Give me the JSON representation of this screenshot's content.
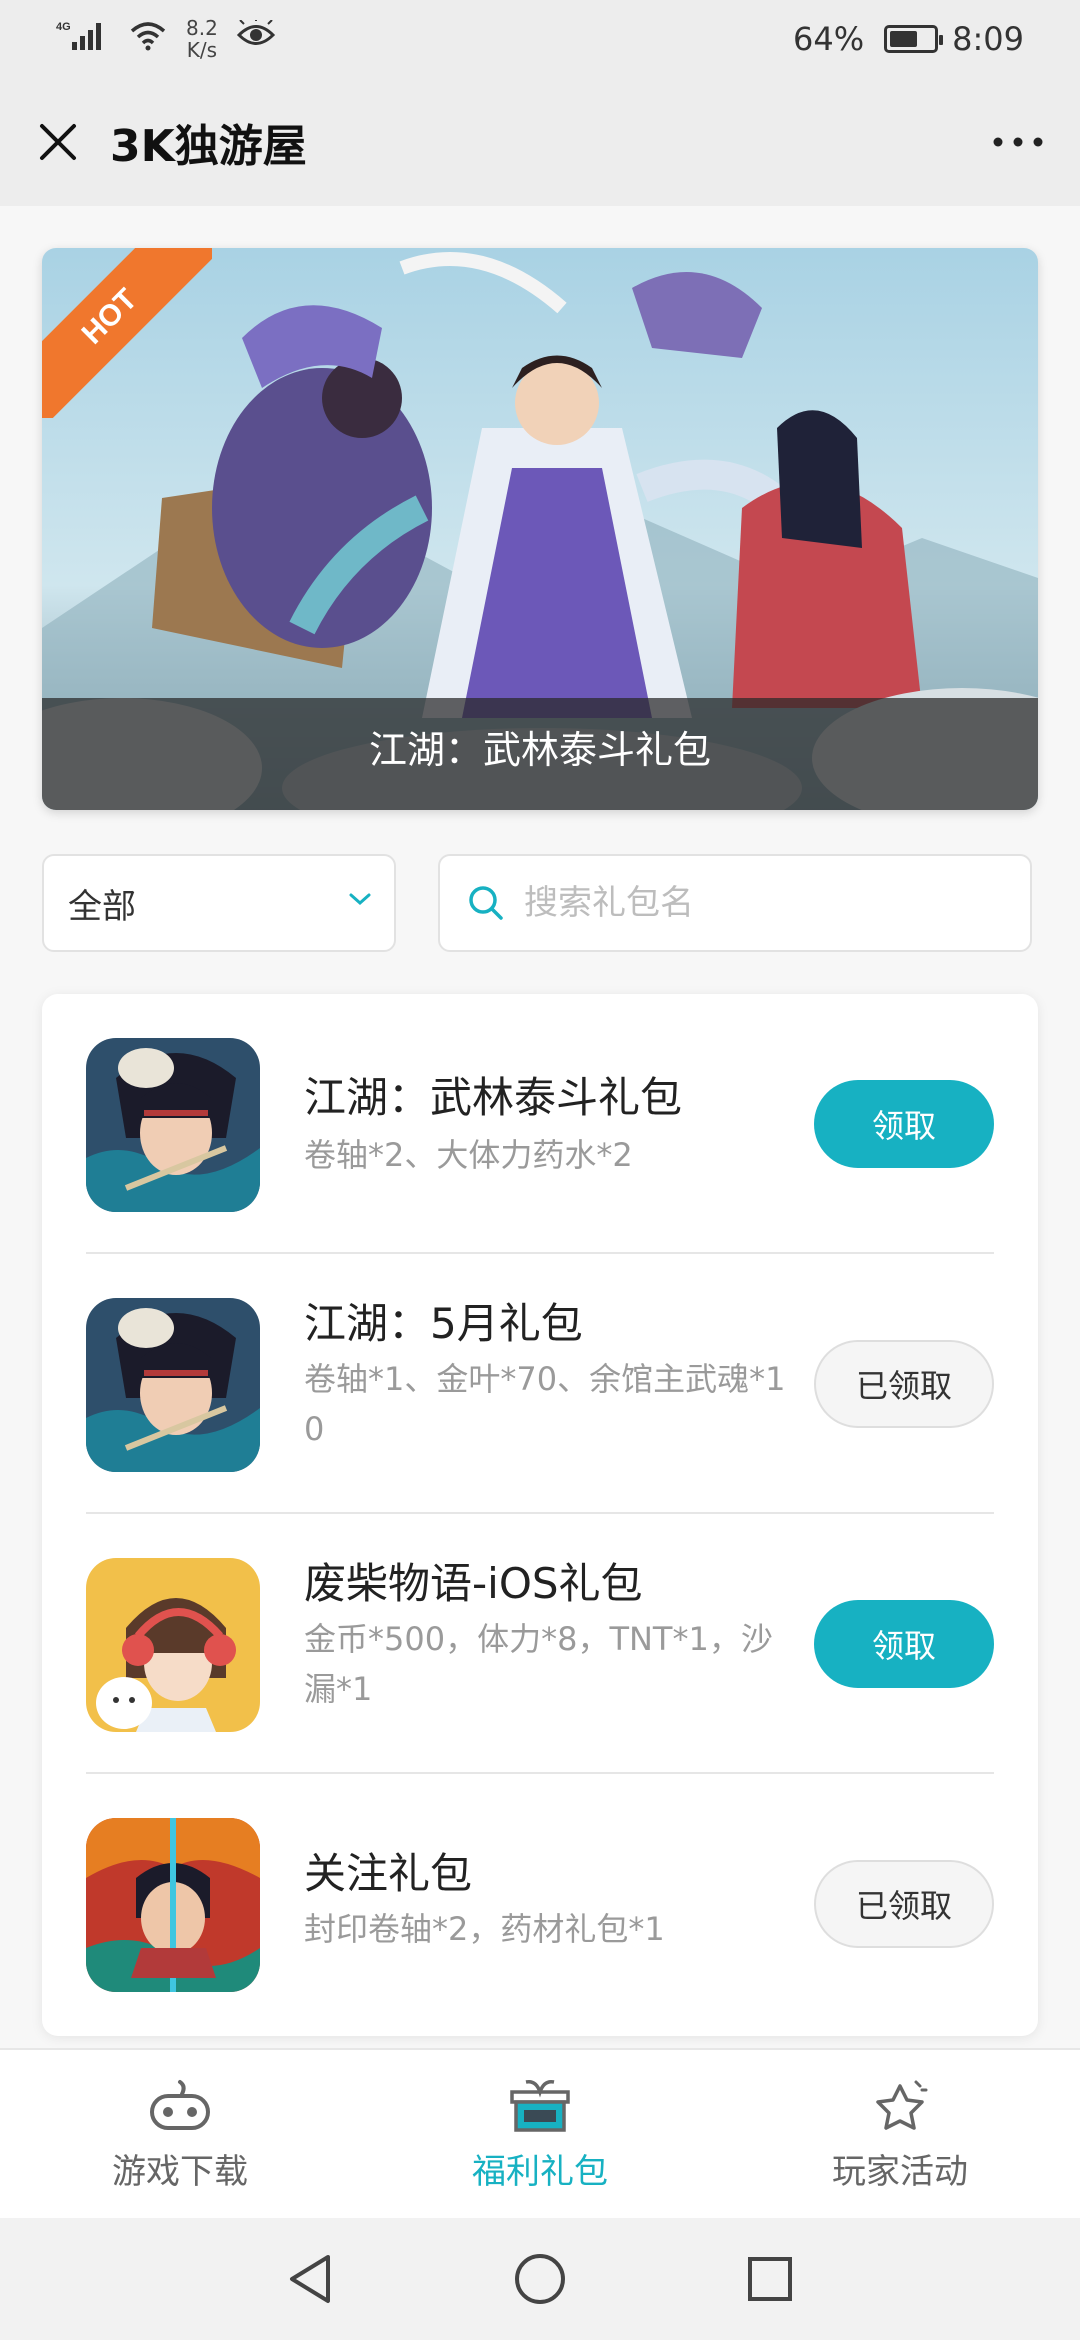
{
  "status_bar": {
    "network": "4G",
    "speed_value": "8.2",
    "speed_unit": "K/s",
    "battery": "64%",
    "battery_level": 0.64,
    "time": "8:09"
  },
  "header": {
    "title": "3K独游屋"
  },
  "banner": {
    "badge": "HOT",
    "caption": "江湖：武林泰斗礼包"
  },
  "filter": {
    "selected": "全部"
  },
  "search": {
    "placeholder": "搜索礼包名"
  },
  "gifts": [
    {
      "name": "江湖：武林泰斗礼包",
      "desc": "卷轴*2、大体力药水*2",
      "button": "领取",
      "claimed": false
    },
    {
      "name": "江湖：5月礼包",
      "desc": "卷轴*1、金叶*70、余馆主武魂*10",
      "button": "已领取",
      "claimed": true
    },
    {
      "name": "废柴物语-iOS礼包",
      "desc": "金币*500，体力*8，TNT*1，沙漏*1",
      "button": "领取",
      "claimed": false
    },
    {
      "name": "关注礼包",
      "desc": "封印卷轴*2，药材礼包*1",
      "button": "已领取",
      "claimed": true
    }
  ],
  "bottom_nav": [
    {
      "label": "游戏下载",
      "icon": "gamepad-icon",
      "active": false
    },
    {
      "label": "福利礼包",
      "icon": "gift-icon",
      "active": true
    },
    {
      "label": "玩家活动",
      "icon": "star-icon",
      "active": false
    }
  ],
  "colors": {
    "accent": "#17b1c2",
    "hot_ribbon": "#f0772d",
    "header_bg": "#ededed"
  }
}
